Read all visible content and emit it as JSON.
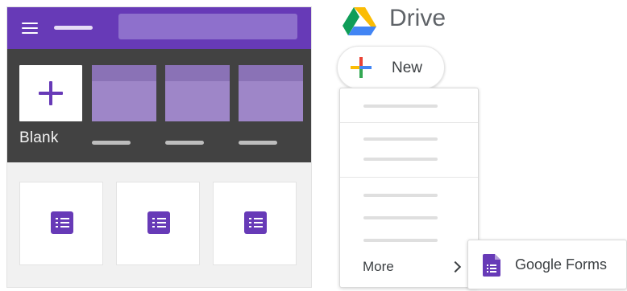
{
  "forms_home": {
    "colors": {
      "header": "#673ab7",
      "gallery_background": "#424242",
      "accent": "#673ab7"
    },
    "gallery": {
      "blank_label": "Blank",
      "templates": [
        "template-1",
        "template-2",
        "template-3"
      ]
    },
    "recent_forms_count": 3
  },
  "drive": {
    "title": "Drive",
    "new_button_label": "New",
    "new_menu": {
      "more_label": "More",
      "submenu": {
        "google_forms_label": "Google Forms"
      }
    }
  },
  "icons": {
    "menu": "hamburger-icon",
    "blank": "plus-icon",
    "form": "form-icon",
    "drive_logo": "drive-logo-icon",
    "new": "multicolor-plus-icon",
    "more": "chevron-right-icon",
    "google_forms": "forms-doc-icon"
  }
}
